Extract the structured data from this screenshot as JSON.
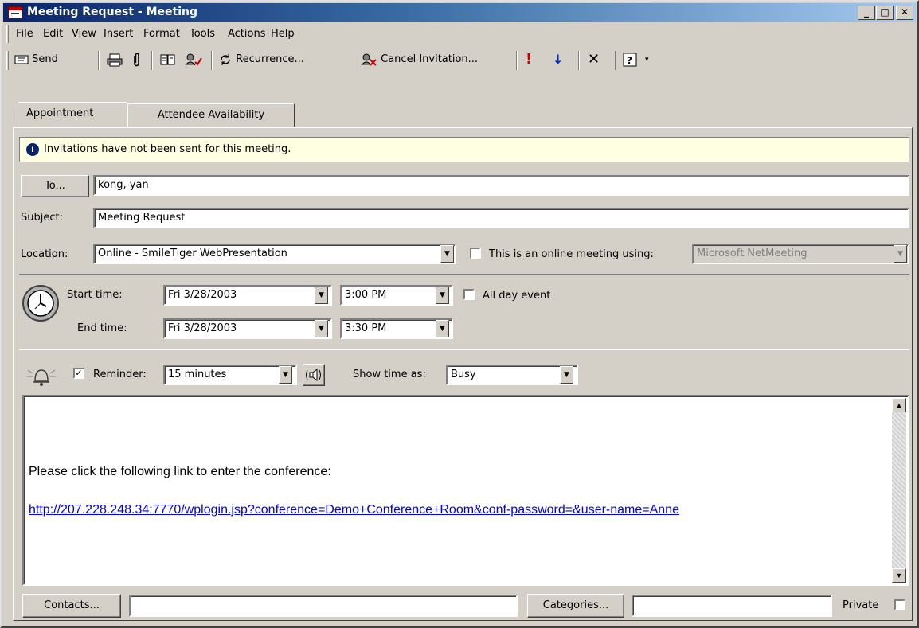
{
  "window": {
    "title": "Meeting Request - Meeting"
  },
  "menu": [
    "File",
    "Edit",
    "View",
    "Insert",
    "Format",
    "Tools",
    "Actions",
    "Help"
  ],
  "toolbar": {
    "send": "Send",
    "recurrence": "Recurrence...",
    "cancel_invitation": "Cancel Invitation..."
  },
  "tabs": [
    "Appointment",
    "Attendee Availability"
  ],
  "info": "Invitations have not been sent for this meeting.",
  "form": {
    "to_button": "To...",
    "to_value": "kong, yan",
    "subject_label": "Subject:",
    "subject_value": "Meeting Request",
    "location_label": "Location:",
    "location_value": "Online - SmileTiger WebPresentation",
    "online_label": "This is an online meeting using:",
    "online_value": "Microsoft NetMeeting",
    "start_label": "Start time:",
    "start_date": "Fri 3/28/2003",
    "start_time": "3:00 PM",
    "allday_label": "All day event",
    "end_label": "End time:",
    "end_date": "Fri 3/28/2003",
    "end_time": "3:30 PM",
    "reminder_label": "Reminder:",
    "reminder_value": "15 minutes",
    "showtime_label": "Show time as:",
    "showtime_value": "Busy"
  },
  "body": {
    "line1": "Please click the following link to enter the conference:",
    "link": "http://207.228.248.34:7770/wplogin.jsp?conference=Demo+Conference+Room&conf-password=&user-name=Anne"
  },
  "footer": {
    "contacts": "Contacts...",
    "categories": "Categories...",
    "private": "Private"
  }
}
